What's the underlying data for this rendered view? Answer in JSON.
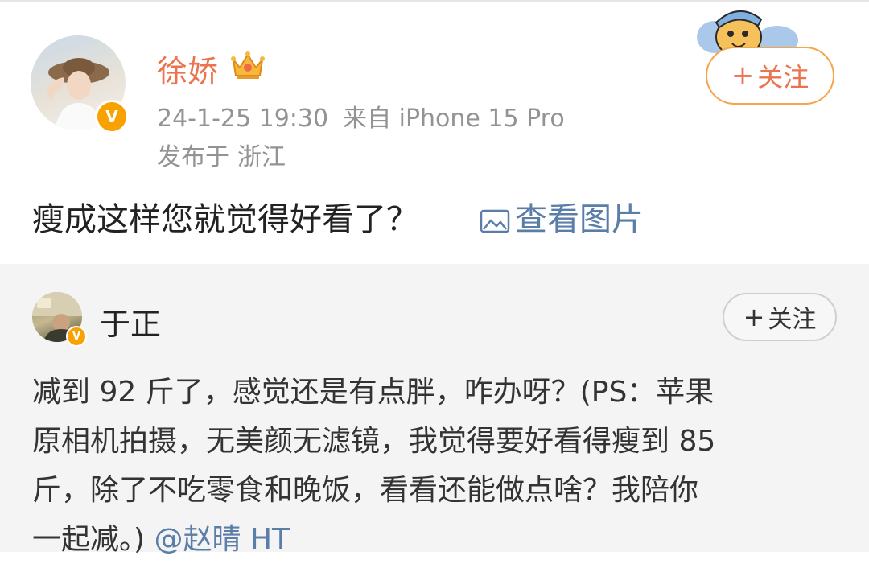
{
  "post": {
    "username": "徐娇",
    "timestamp": "24-1-25 19:30",
    "source": "来自 iPhone 15 Pro",
    "location_label": "发布于",
    "location_value": "浙江",
    "text": "瘦成这样您就觉得好看了？",
    "view_image_label": "查看图片",
    "follow_plus": "+",
    "follow_label": "关注",
    "verified_mark": "V"
  },
  "repost": {
    "username": "于正",
    "follow_plus": "+",
    "follow_label": "关注",
    "verified_mark": "V",
    "lines": [
      "减到 92 斤了，感觉还是有点胖，咋办呀？(PS：苹果",
      "原相机拍摄，无美颜无滤镜，我觉得要好看得瘦到 85",
      "斤，除了不吃零食和晚饭，看看还能做点啥？我陪你"
    ],
    "last_line_prefix": "一起减。) ",
    "mention": "@赵晴 HT"
  },
  "colors": {
    "username_orange": "#eb7350",
    "link_blue": "#5b7ea8",
    "meta_gray": "#939393",
    "follow_border": "#f5a54a",
    "verified_badge": "#f7a200"
  },
  "icons": [
    "crown-icon",
    "mascot-icon",
    "image-icon",
    "verified-badge-icon",
    "plus-icon"
  ]
}
